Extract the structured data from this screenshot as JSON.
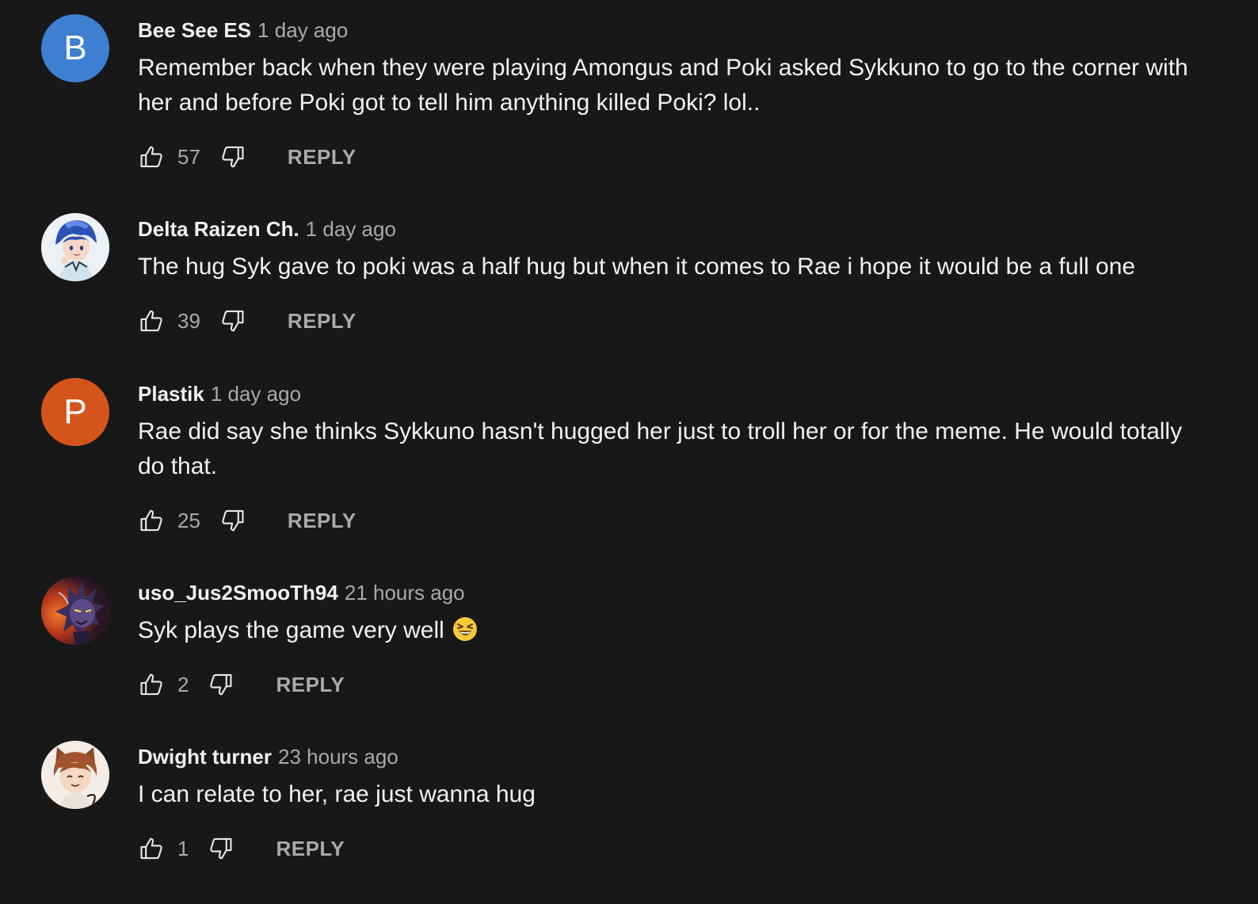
{
  "comments": [
    {
      "author": "Bee See ES",
      "time": "1 day ago",
      "text": "Remember back when they were playing Amongus and Poki asked Sykkuno to go to the corner with her and before Poki got to tell him anything killed Poki? lol..",
      "likes": "57",
      "reply_label": "REPLY",
      "avatar_letter": "B",
      "avatar_color": "#3d7fd0"
    },
    {
      "author": "Delta Raizen Ch.",
      "time": "1 day ago",
      "text": "The hug Syk gave to poki was a half hug but when it comes to Rae i hope it would be a full one",
      "likes": "39",
      "reply_label": "REPLY",
      "avatar_icon": "anime-character-avatar-icon"
    },
    {
      "author": "Plastik",
      "time": "1 day ago",
      "text": "Rae did say she thinks Sykkuno hasn't hugged her just to troll her or for the meme. He would totally do that.",
      "likes": "25",
      "reply_label": "REPLY",
      "avatar_letter": "P",
      "avatar_color": "#d5541e"
    },
    {
      "author": "uso_Jus2SmooTh94",
      "time": "21 hours ago",
      "text": "Syk plays the game very well",
      "emoji": "laughing-squinting-face-emoji",
      "likes": "2",
      "reply_label": "REPLY",
      "avatar_icon": "dark-character-avatar-icon"
    },
    {
      "author": "Dwight turner",
      "time": "23 hours ago",
      "text": "I can relate to her, rae just wanna hug",
      "likes": "1",
      "reply_label": "REPLY",
      "avatar_icon": "cat-ear-character-avatar-icon"
    }
  ],
  "theme": {
    "background": "#181818",
    "text_primary": "#f1f1f1",
    "text_secondary": "#aaaaaa"
  }
}
